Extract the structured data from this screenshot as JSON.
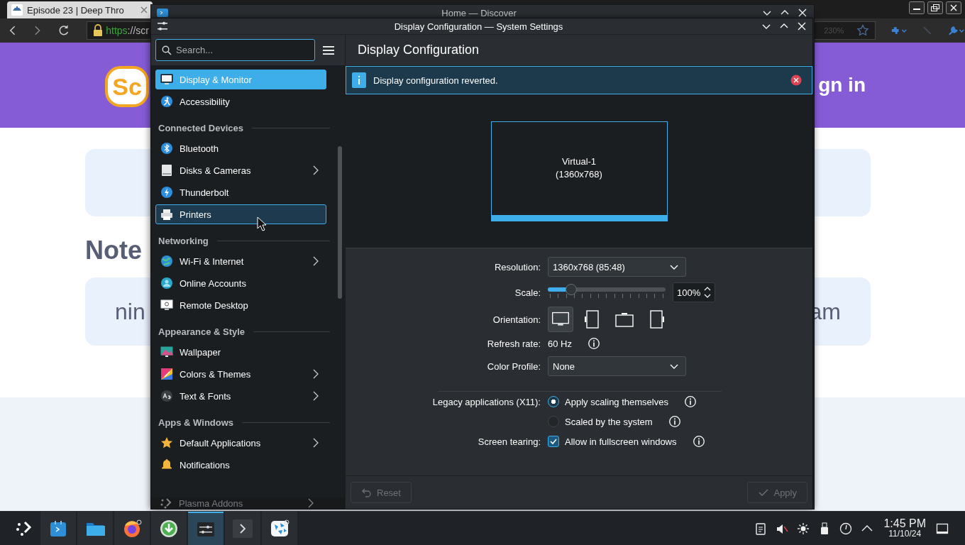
{
  "browser": {
    "tab": {
      "title": "Episode 23 | Deep Thro"
    },
    "address_scheme": "https",
    "address_rest": "://scr",
    "zoom": "230%",
    "page": {
      "logo": "Sc",
      "sign_in": "gn in",
      "heading": "Note",
      "card_left": "nin",
      "card_right": "am"
    }
  },
  "discover_window": {
    "title": "Home — Discover"
  },
  "settings": {
    "title": "Display Configuration — System Settings",
    "search": {
      "placeholder": "Search..."
    },
    "sidebar": [
      {
        "kind": "item",
        "label": "Display & Monitor",
        "selected": true,
        "hovered": false,
        "chevron": false
      },
      {
        "kind": "item",
        "label": "Accessibility",
        "selected": false,
        "hovered": false,
        "chevron": false
      },
      {
        "kind": "header",
        "label": "Connected Devices"
      },
      {
        "kind": "item",
        "label": "Bluetooth",
        "selected": false,
        "hovered": false,
        "chevron": false
      },
      {
        "kind": "item",
        "label": "Disks & Cameras",
        "selected": false,
        "hovered": false,
        "chevron": true
      },
      {
        "kind": "item",
        "label": "Thunderbolt",
        "selected": false,
        "hovered": false,
        "chevron": false
      },
      {
        "kind": "item",
        "label": "Printers",
        "selected": false,
        "hovered": true,
        "chevron": false
      },
      {
        "kind": "header",
        "label": "Networking"
      },
      {
        "kind": "item",
        "label": "Wi-Fi & Internet",
        "selected": false,
        "hovered": false,
        "chevron": true
      },
      {
        "kind": "item",
        "label": "Online Accounts",
        "selected": false,
        "hovered": false,
        "chevron": false
      },
      {
        "kind": "item",
        "label": "Remote Desktop",
        "selected": false,
        "hovered": false,
        "chevron": false
      },
      {
        "kind": "header",
        "label": "Appearance & Style"
      },
      {
        "kind": "item",
        "label": "Wallpaper",
        "selected": false,
        "hovered": false,
        "chevron": false
      },
      {
        "kind": "item",
        "label": "Colors & Themes",
        "selected": false,
        "hovered": false,
        "chevron": true
      },
      {
        "kind": "item",
        "label": "Text & Fonts",
        "selected": false,
        "hovered": false,
        "chevron": true
      },
      {
        "kind": "header",
        "label": "Apps & Windows"
      },
      {
        "kind": "item",
        "label": "Default Applications",
        "selected": false,
        "hovered": false,
        "chevron": true
      },
      {
        "kind": "item",
        "label": "Notifications",
        "selected": false,
        "hovered": false,
        "chevron": false
      }
    ],
    "sidebar_footer": {
      "label": "Plasma Addons",
      "chevron": true
    },
    "page_title": "Display Configuration",
    "message": {
      "text": "Display configuration reverted."
    },
    "preview": {
      "name": "Virtual-1",
      "size": "(1360x768)",
      "selected": true
    },
    "form": [
      {
        "kind": "dropdown",
        "label": "Resolution:",
        "value": "1360x768 (85:48)"
      },
      {
        "kind": "slider",
        "label": "Scale:",
        "level": 0.2,
        "value": "100%"
      },
      {
        "kind": "orientation",
        "label": "Orientation:",
        "options": [
          {
            "selected": true
          },
          {
            "selected": false
          },
          {
            "selected": false
          },
          {
            "selected": false
          }
        ]
      },
      {
        "kind": "text",
        "label": "Refresh rate:",
        "value": "60 Hz",
        "info": true
      },
      {
        "kind": "dropdown",
        "label": "Color Profile:",
        "value": "None"
      },
      {
        "kind": "separator"
      },
      {
        "kind": "radio",
        "label": "Legacy applications (X11):",
        "options": [
          {
            "label": "Apply scaling themselves",
            "selected": true,
            "info": true
          },
          {
            "label": "Scaled by the system",
            "selected": false,
            "info": true
          }
        ]
      },
      {
        "kind": "checkbox",
        "label": "Screen tearing:",
        "option": "Allow in fullscreen windows",
        "checked": true,
        "info": true
      }
    ],
    "buttons": [
      {
        "kind": "reset",
        "label": "Reset",
        "disabled": true
      },
      {
        "kind": "apply",
        "label": "Apply",
        "disabled": true
      }
    ]
  },
  "taskbar": {
    "tasks": [
      {
        "selected": false
      },
      {
        "selected": false
      },
      {
        "selected": false
      },
      {
        "selected": false
      },
      {
        "selected": true
      },
      {
        "selected": false
      },
      {
        "selected": false
      }
    ],
    "clock": {
      "time": "1:45 PM",
      "date": "11/10/24"
    }
  }
}
